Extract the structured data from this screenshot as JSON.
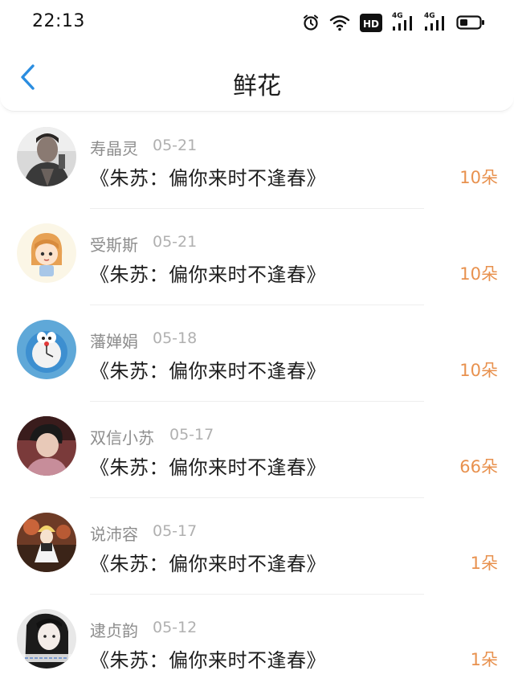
{
  "status_bar": {
    "time": "22:13",
    "hd_label": "HD",
    "network_labels": [
      "4G",
      "4G"
    ],
    "icons": [
      "alarm-icon",
      "wifi-icon",
      "hd-icon",
      "signal-4g-icon",
      "signal-4g-icon",
      "battery-icon"
    ]
  },
  "header": {
    "title": "鲜花",
    "back_icon": "chevron-left-icon"
  },
  "colors": {
    "accent": "#2a8de0",
    "count": "#e8914e",
    "name": "#8d8d8d",
    "date": "#b0b0b0"
  },
  "items": [
    {
      "name": "寿晶灵",
      "date": "05-21",
      "book": "《朱苏：偏你来时不逢春》",
      "count": "10朵"
    },
    {
      "name": "受斯斯",
      "date": "05-21",
      "book": "《朱苏：偏你来时不逢春》",
      "count": "10朵"
    },
    {
      "name": "藩婵娟",
      "date": "05-18",
      "book": "《朱苏：偏你来时不逢春》",
      "count": "10朵"
    },
    {
      "name": "双信小苏",
      "date": "05-17",
      "book": "《朱苏：偏你来时不逢春》",
      "count": "66朵"
    },
    {
      "name": "说沛容",
      "date": "05-17",
      "book": "《朱苏：偏你来时不逢春》",
      "count": "1朵"
    },
    {
      "name": "逮贞韵",
      "date": "05-12",
      "book": "《朱苏：偏你来时不逢春》",
      "count": "1朵"
    }
  ]
}
